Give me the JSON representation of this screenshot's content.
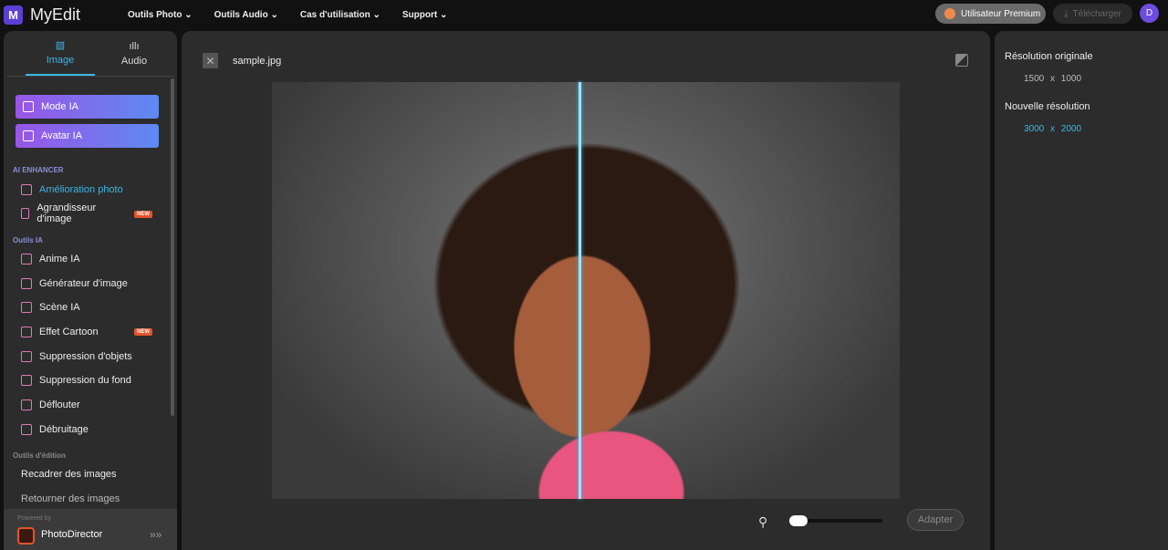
{
  "header": {
    "logo_mark": "M",
    "app_name": "MyEdit",
    "nav": [
      "Outils Photo",
      "Outils Audio",
      "Cas d'utilisation",
      "Support"
    ],
    "premium": "Utilisateur Premium",
    "download": "Télécharger",
    "avatar": "D"
  },
  "sidebar": {
    "tabs": [
      "Image",
      "Audio"
    ],
    "buttons": [
      "Mode IA",
      "Avatar IA"
    ],
    "sections": {
      "enhancer": "AI ENHANCER",
      "tools": "Outils IA",
      "edit": "Outils d'édition"
    },
    "enhancer_items": [
      {
        "label": "Amélioration photo"
      },
      {
        "label": "Agrandisseur d'image",
        "badge": "NEW"
      }
    ],
    "ai_items": [
      {
        "label": "Anime IA"
      },
      {
        "label": "Générateur d'image"
      },
      {
        "label": "Scène IA"
      },
      {
        "label": "Effet Cartoon",
        "badge": "NEW"
      },
      {
        "label": "Suppression d'objets"
      },
      {
        "label": "Suppression du fond"
      },
      {
        "label": "Déflouter"
      },
      {
        "label": "Débruitage"
      }
    ],
    "edit_items": [
      "Recadrer des images",
      "Retourner des images"
    ],
    "powered_by": "Powered by",
    "partner": "PhotoDirector"
  },
  "editor": {
    "filename": "sample.jpg",
    "zoom_level": 0,
    "fit_button": "Adapter"
  },
  "info": {
    "orig_label": "Résolution originale",
    "orig_value": "1500 x 1000",
    "new_label": "Nouvelle résolution",
    "new_value": "3000 x 2000"
  }
}
